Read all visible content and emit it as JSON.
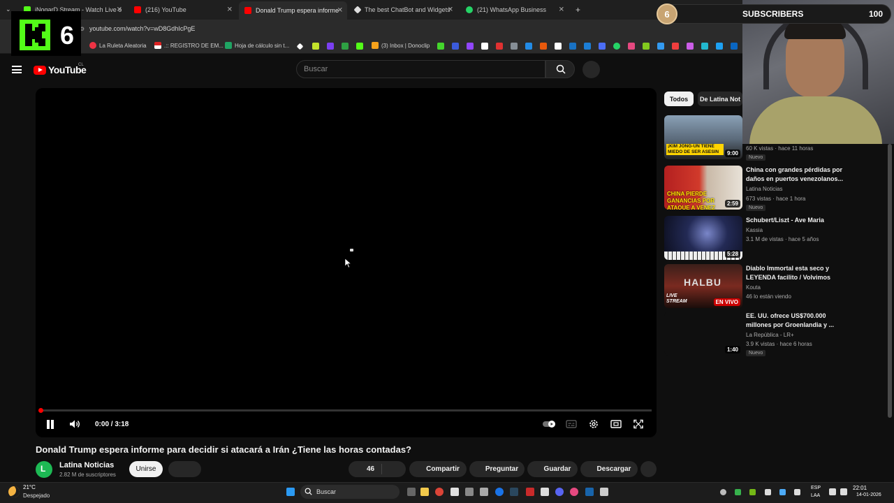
{
  "browser": {
    "tabs": [
      {
        "title": "iNoqarD Stream - Watch Live o"
      },
      {
        "title": "(216) YouTube"
      },
      {
        "title": "Donald Trump espera informe"
      },
      {
        "title": "The best ChatBot and Widgets"
      },
      {
        "title": "(21) WhatsApp Business"
      }
    ],
    "url": "youtube.com/watch?v=wD8GdhIcPgE",
    "bookmarks": [
      {
        "label": "La Ruleta Aleatoria"
      },
      {
        "label": ".:: REGISTRO DE EM..."
      },
      {
        "label": "Hoja de cálculo sin t..."
      },
      {
        "label": "(3) Inbox | Donoclip"
      }
    ]
  },
  "overlay": {
    "kick_count": "6",
    "subscribers_current": "6",
    "subscribers_label": "SUBSCRIBERS",
    "subscribers_goal": "100"
  },
  "youtube": {
    "logo_text": "YouTube",
    "country": "CL",
    "search_placeholder": "Buscar",
    "player": {
      "time": "0:00 / 3:18"
    },
    "video_title": "Donald Trump espera informe para decidir si atacará a Irán ¿Tiene las horas contadas?",
    "channel": {
      "name": "Latina Noticias",
      "subscribers": "2.82 M de suscriptores",
      "join_label": "Unirse"
    },
    "actions": {
      "likes": "46",
      "share": "Compartir",
      "ask": "Preguntar",
      "save": "Guardar",
      "download": "Descargar"
    },
    "chips": [
      "Todos",
      "De Latina Not"
    ],
    "related": [
      {
        "title": "",
        "channel": "",
        "meta": "60 K vistas · hace 11 horas",
        "badge": "Nuevo",
        "duration": "9:00",
        "thumb_text": "¡KIM JONG-UN TIENE MIEDO DE SER ASESIN"
      },
      {
        "title": "China con grandes pérdidas por daños en puertos venezolanos...",
        "channel": "Latina Noticias",
        "meta": "673 vistas · hace 1 hora",
        "badge": "Nuevo",
        "duration": "2:59",
        "thumb_text": "CHINA PIERDE GANANCIAS POR ATAQUE A VENEZ"
      },
      {
        "title": "Schubert/Liszt - Ave Maria",
        "channel": "Kassia",
        "meta": "3.1 M de vistas · hace 5 años",
        "badge": "",
        "duration": "5:28",
        "thumb_text": ""
      },
      {
        "title": "Diablo Immortal esta seco y LEYENDA facilito / Volvimos",
        "channel": "Kouta",
        "meta": "46 lo están viendo",
        "badge": "",
        "duration": "",
        "live_label": "EN VIVO",
        "thumb_text": "LIVE STREAM",
        "thumb_title": "HALBU"
      },
      {
        "title": "EE. UU. ofrece US$700.000 millones por Groenlandia y ...",
        "channel": "La República - LR+",
        "meta": "3.9 K vistas · hace 6 horas",
        "badge": "Nuevo",
        "duration": "1:40",
        "thumb_text": ""
      }
    ]
  },
  "taskbar": {
    "temperature": "21°C",
    "weather": "Despejado",
    "search": "Buscar",
    "lang1": "ESP",
    "lang2": "LAA",
    "time": "22:01",
    "date": "14-01-2026"
  },
  "colors": {
    "yt_red": "#ff0000",
    "kick_green": "#53fc18",
    "background": "#0f0f0f"
  }
}
